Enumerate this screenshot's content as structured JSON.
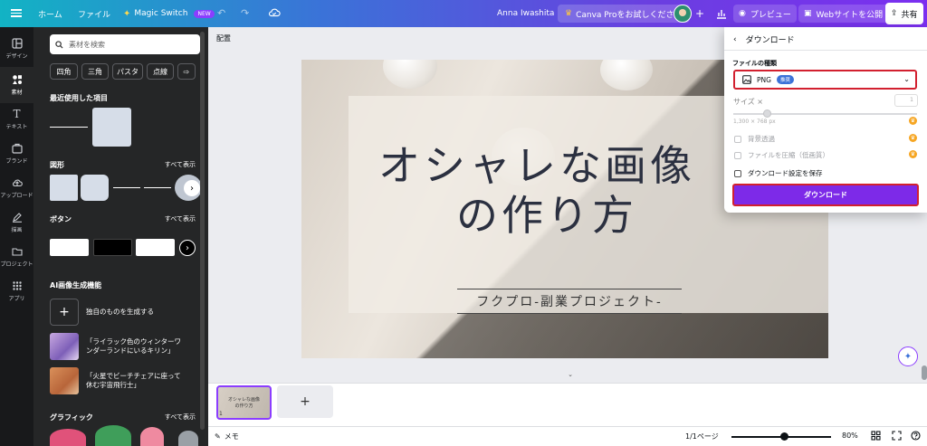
{
  "topbar": {
    "home": "ホーム",
    "file": "ファイル",
    "magic_switch": "Magic Switch",
    "new_badge": "NEW",
    "user_name": "Anna Iwashita",
    "try_pro": "Canva Proをお試しください",
    "preview": "プレビュー",
    "publish": "Webサイトを公開",
    "share": "共有"
  },
  "rail": {
    "items": [
      {
        "label": "デザイン"
      },
      {
        "label": "素材"
      },
      {
        "label": "テキスト"
      },
      {
        "label": "ブランド"
      },
      {
        "label": "アップロード"
      },
      {
        "label": "描画"
      },
      {
        "label": "プロジェクト"
      },
      {
        "label": "アプリ"
      }
    ]
  },
  "panel": {
    "search_placeholder": "素材を検索",
    "chips": [
      "四角",
      "三角",
      "パスタ",
      "点線"
    ],
    "recent_title": "最近使用した項目",
    "shapes_title": "図形",
    "shapes_see_all": "すべて表示",
    "buttons_title": "ボタン",
    "buttons_see_all": "すべて表示",
    "ai_title": "AI画像生成機能",
    "ai_items": [
      {
        "text": "独自のものを生成する"
      },
      {
        "text_line1": "「ライラック色のウィンターワ",
        "text_line2": "ンダーランドにいるキリン」"
      },
      {
        "text_line1": "「火星でビーチチェアに座って",
        "text_line2": "休む宇宙飛行士」"
      }
    ],
    "graphics_title": "グラフィック",
    "graphics_see_all": "すべて表示"
  },
  "canvas": {
    "arrange": "配置",
    "title_line1": "オシャレな画像",
    "title_line2": "の作り方",
    "subtitle": "フクプロ-副業プロジェクト-"
  },
  "pages": {
    "thumb_text_line1": "オシャレな画像",
    "thumb_text_line2": "の作り方",
    "page_number": "1"
  },
  "bottombar": {
    "memo": "メモ",
    "page_count": "1/1ページ",
    "zoom": "80%"
  },
  "download": {
    "title": "ダウンロード",
    "file_type_label": "ファイルの種類",
    "file_type_value": "PNG",
    "file_type_badge": "推奨",
    "size_label": "サイズ ×",
    "size_value": "1",
    "dimensions": "1,300 × 768 px",
    "option_transparent": "背景透過",
    "option_compress": "ファイルを圧縮（低画質）",
    "option_save_settings": "ダウンロード設定を保存",
    "button": "ダウンロード"
  },
  "colors": {
    "accent": "#7d2ae8",
    "highlight_border": "#d2202f",
    "panel_bg": "#252627",
    "rail_bg": "#18191b"
  }
}
